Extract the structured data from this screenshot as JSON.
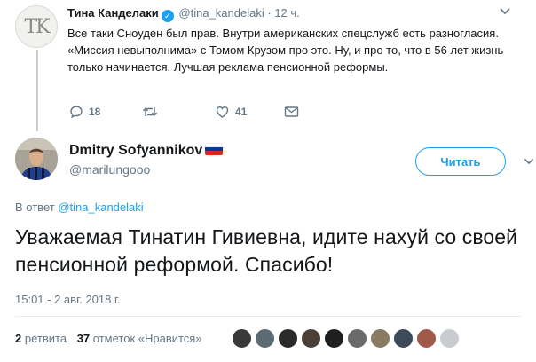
{
  "parent_tweet": {
    "avatar_monogram": "TK",
    "name": "Тина Канделаки",
    "handle": "@tina_kandelaki",
    "separator": "·",
    "time": "12 ч.",
    "text": "Все таки Сноуден был прав. Внутри американских спецслужб есть разногласия. «Миссия невыполнима» с Томом Крузом про это. Ну, и про то, что в 56 лет жизнь только начинается. Лучшая реклама пенсионной реформы.",
    "replies": "18",
    "retweets": "",
    "likes": "41",
    "icons": [
      "reply-icon",
      "retweet-icon",
      "heart-icon",
      "message-icon"
    ]
  },
  "main_tweet": {
    "name": "Dmitry Sofyannikov",
    "flag": "russia-flag",
    "handle": "@marilungooo",
    "follow_label": "Читать",
    "reply_prefix": "В ответ",
    "reply_handle": "@tina_kandelaki",
    "text": "Уважаемая Тинатин Гивиевна, идите нахуй со своей пенсионной реформой. Спасибо!",
    "timestamp": "15:01 - 2 авг. 2018 г.",
    "retweet_count": "2",
    "retweet_label": "ретвита",
    "like_count": "37",
    "like_label": "отметок «Нравится»"
  },
  "colors": {
    "accent": "#1da1f2",
    "text": "#14171a",
    "muted": "#657786",
    "divider": "#e6ecf0"
  }
}
